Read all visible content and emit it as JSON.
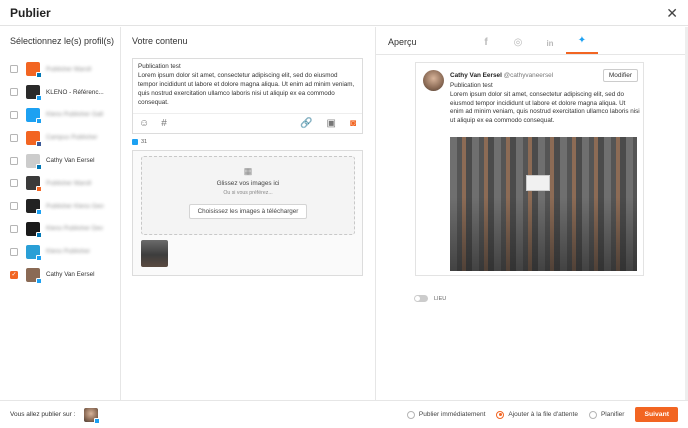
{
  "header": {
    "title": "Publier",
    "close_icon": "close-icon"
  },
  "profiles": {
    "title": "Sélectionnez le(s) profil(s)",
    "items": [
      {
        "name": "Publisher Maroll",
        "blurred": true,
        "checked": false,
        "avatar_color": "#f26522",
        "network_color": "#0077b5"
      },
      {
        "name": "KLENO - Référenc...",
        "blurred": false,
        "checked": false,
        "avatar_color": "#2a2a2a",
        "network_color": "#1da1f2"
      },
      {
        "name": "Kleno Publisher Gall",
        "blurred": true,
        "checked": false,
        "avatar_color": "#1da1f2",
        "network_color": "#1da1f2"
      },
      {
        "name": "Campus Publisher",
        "blurred": true,
        "checked": false,
        "avatar_color": "#f26522",
        "network_color": "#3b5998"
      },
      {
        "name": "Cathy Van Eersel",
        "blurred": false,
        "checked": false,
        "avatar_color": "#cccccc",
        "network_color": "#0077b5"
      },
      {
        "name": "Publisher Maroll",
        "blurred": true,
        "checked": false,
        "avatar_color": "#3a3a3a",
        "network_color": "#f26522"
      },
      {
        "name": "Publisher Kleno Gen",
        "blurred": true,
        "checked": false,
        "avatar_color": "#222222",
        "network_color": "#1da1f2"
      },
      {
        "name": "Kleno Publisher Dev",
        "blurred": true,
        "checked": false,
        "avatar_color": "#1a1a1a",
        "network_color": "#0077b5"
      },
      {
        "name": "Kleno Publisher",
        "blurred": true,
        "checked": false,
        "avatar_color": "#2a9fd6",
        "network_color": "#1da1f2"
      },
      {
        "name": "Cathy Van Eersel",
        "blurred": false,
        "checked": true,
        "avatar_color": "#8a6a55",
        "network_color": "#1da1f2"
      }
    ]
  },
  "content": {
    "title": "Votre contenu",
    "post_title": "Publication test",
    "post_body": "Lorem ipsum dolor sit amet, consectetur adipiscing elit, sed do eiusmod tempor incididunt ut labore et dolore magna aliqua. Ut enim ad minim veniam, quis nostrud exercitation ullamco laboris nisi ut aliquip ex ea commodo consequat.",
    "toolbar_icons": [
      "emoji-icon",
      "hashtag-icon",
      "link-icon",
      "gallery-icon",
      "camera-icon"
    ],
    "char_count": "31",
    "dropzone": {
      "main": "Glissez vos images ici",
      "sub": "Ou si vous préférez...",
      "button": "Choisissez les images à télécharger"
    }
  },
  "preview": {
    "title": "Aperçu",
    "tabs": [
      "facebook-icon",
      "instagram-icon",
      "linkedin-icon",
      "twitter-icon"
    ],
    "active_tab": "twitter-icon",
    "tweet": {
      "name": "Cathy Van Eersel",
      "handle": "@cathyvaneersel",
      "edit_label": "Modifier",
      "title": "Publication test",
      "body": "Lorem ipsum dolor sit amet, consectetur adipiscing elit, sed do eiusmod tempor incididunt ut labore et dolore magna aliqua. Ut enim ad minim veniam, quis nostrud exercitation ullamco laboris nisi ut aliquip ex ea commodo consequat."
    },
    "location_label": "LIEU"
  },
  "footer": {
    "publish_on_label": "Vous allez publier sur :",
    "options": [
      {
        "label": "Publier immédiatement",
        "selected": false
      },
      {
        "label": "Ajouter à la file d'attente",
        "selected": true
      },
      {
        "label": "Planifier",
        "selected": false
      }
    ],
    "next_label": "Suivant"
  },
  "colors": {
    "accent": "#f26522",
    "twitter": "#1da1f2"
  }
}
